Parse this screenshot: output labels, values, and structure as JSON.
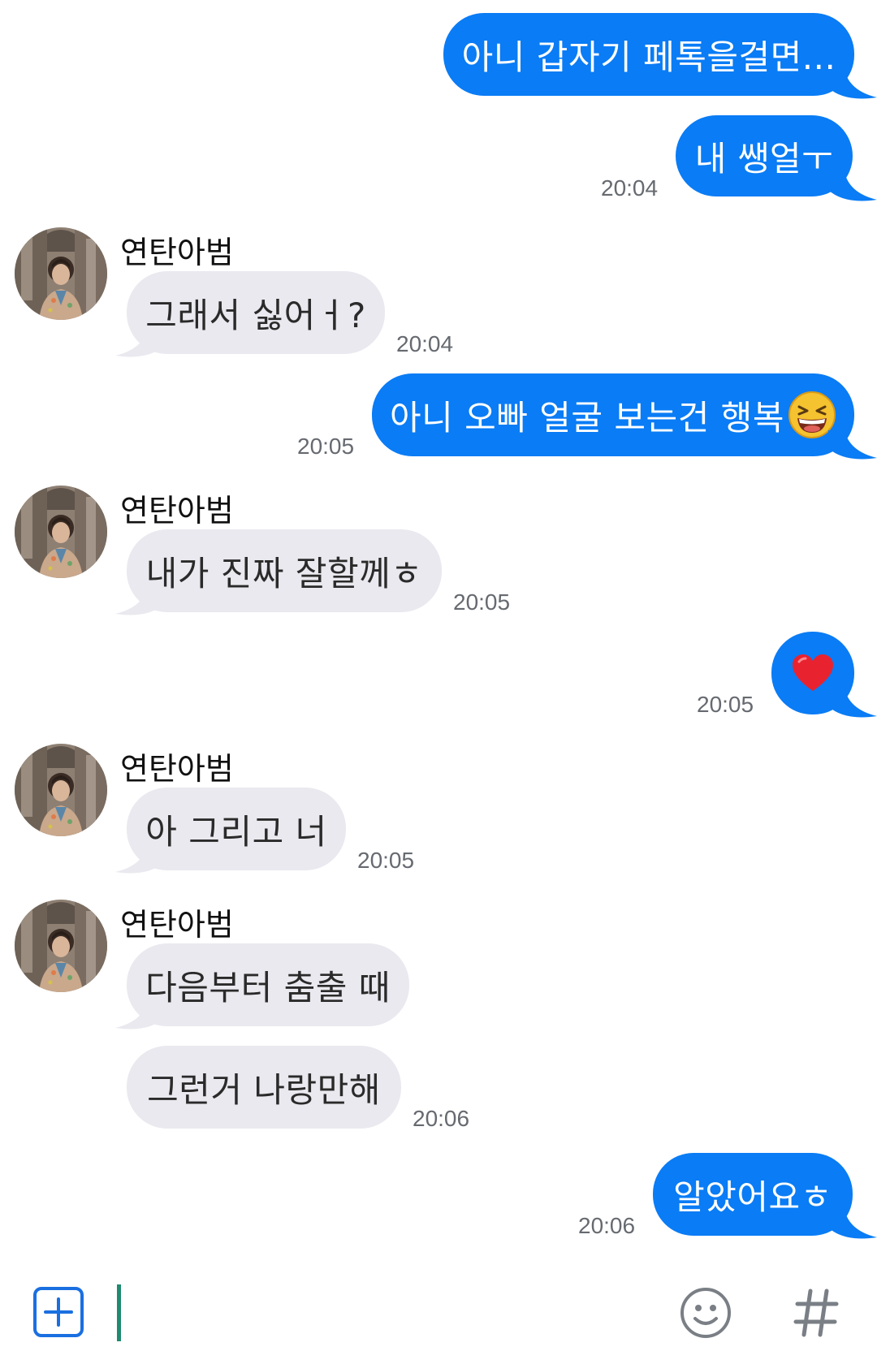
{
  "contact": {
    "name": "연탄아범"
  },
  "icons": {
    "avatar": "profile-photo",
    "laughing_emoji": "grinning-squinting-face",
    "heart_emoji": "red-heart",
    "plus": "plus-square-icon",
    "emoji_button": "smiley-icon",
    "hashtag": "hashtag-icon"
  },
  "colors": {
    "sent_bubble": "#0a7cf5",
    "received_bubble": "#e9e9ef",
    "cursor": "#1f8a70"
  },
  "messages": [
    {
      "from": "me",
      "text": "아니 갑자기 페톡을걸면..."
    },
    {
      "from": "me",
      "text": "내 쌩얼ㅜ",
      "time": "20:04"
    },
    {
      "from": "them",
      "text": "그래서 싫어ㅓ?",
      "time": "20:04"
    },
    {
      "from": "me",
      "text": "아니 오빠 얼굴 보는건 행복",
      "time": "20:05"
    },
    {
      "from": "them",
      "text": "내가 진짜 잘할께ㅎ",
      "time": "20:05"
    },
    {
      "from": "me",
      "text": "",
      "time": "20:05"
    },
    {
      "from": "them",
      "text": "아 그리고 너",
      "time": "20:05"
    },
    {
      "from": "them",
      "text": "다음부터 춤출 때"
    },
    {
      "from": "them",
      "text": "그런거 나랑만해",
      "time": "20:06"
    },
    {
      "from": "me",
      "text": "알았어요ㅎ",
      "time": "20:06"
    }
  ],
  "composer": {
    "value": ""
  }
}
